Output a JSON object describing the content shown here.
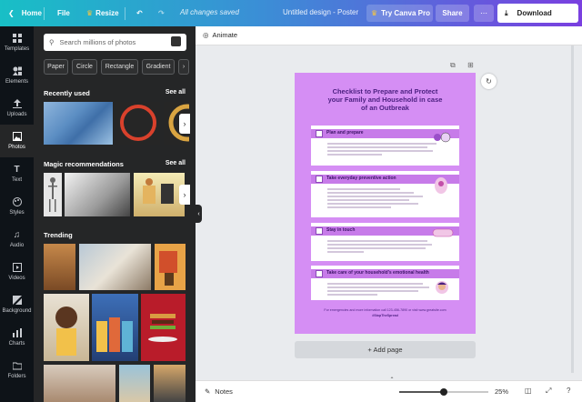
{
  "topbar": {
    "home": "Home",
    "file": "File",
    "resize": "Resize",
    "saved": "All changes saved",
    "title": "Untitled design - Poster",
    "pro": "Try Canva Pro",
    "share": "Share",
    "download": "Download"
  },
  "rail": [
    {
      "label": "Templates",
      "icon": "templates-icon"
    },
    {
      "label": "Elements",
      "icon": "elements-icon"
    },
    {
      "label": "Uploads",
      "icon": "upload-icon"
    },
    {
      "label": "Photos",
      "icon": "photo-icon"
    },
    {
      "label": "Text",
      "icon": "text-icon"
    },
    {
      "label": "Styles",
      "icon": "styles-icon"
    },
    {
      "label": "Audio",
      "icon": "audio-icon"
    },
    {
      "label": "Videos",
      "icon": "video-icon"
    },
    {
      "label": "Background",
      "icon": "background-icon"
    },
    {
      "label": "Charts",
      "icon": "chart-icon"
    },
    {
      "label": "Folders",
      "icon": "folder-icon"
    }
  ],
  "panel": {
    "search_placeholder": "Search millions of photos",
    "filters": [
      "Paper",
      "Circle",
      "Rectangle",
      "Gradient"
    ],
    "recently_used": "Recently used",
    "magic": "Magic recommendations",
    "trending": "Trending",
    "see_all": "See all"
  },
  "canvas": {
    "animate": "Animate",
    "poster_title_1": "Checklist to Prepare and Protect",
    "poster_title_2": "your Family and Household in case",
    "poster_title_3": "of an Outbreak",
    "cards": [
      {
        "heading": "Plan and prepare"
      },
      {
        "heading": "Take everyday preventive action"
      },
      {
        "heading": "Stay in touch"
      },
      {
        "heading": "Take care of your household's emotional health"
      }
    ],
    "foot_1": "For emergencies and more information call 123-456-7890 or visit www.greatsite.com",
    "foot_2": "#StopTheSpread",
    "add_page": "+ Add page"
  },
  "bottombar": {
    "notes": "Notes",
    "zoom": "25%",
    "zoom_level": 0.5
  },
  "colors": {
    "accent_gradient_start": "#18bfc6",
    "accent_gradient_end": "#7a3fe0",
    "poster_bg": "#d58ef4",
    "poster_text": "#4b1f80"
  }
}
